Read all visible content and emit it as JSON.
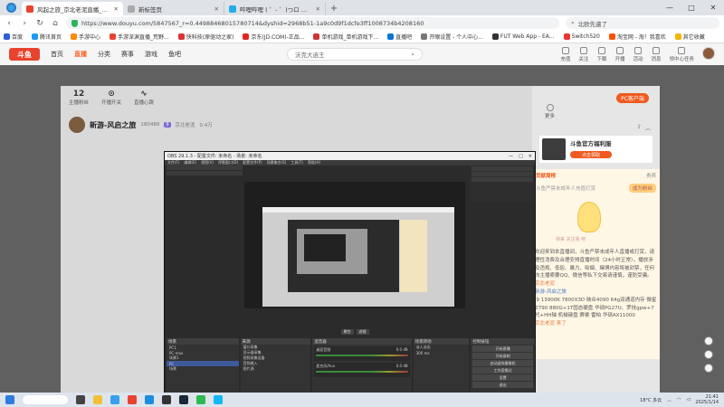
{
  "browser": {
    "tabs": [
      {
        "title": "风起之旅_京北老泥直播_斗鱼",
        "active": true,
        "color": "#e8432f"
      },
      {
        "title": "新标签页",
        "active": false,
        "color": "#aaa"
      },
      {
        "title": "哔哩哔哩 ( ゜- ゜)つロ 干杯~",
        "active": false,
        "color": "#23ade5"
      }
    ],
    "new_tab": "+",
    "window_controls": [
      "—",
      "□",
      "✕"
    ],
    "url": "https://www.douyu.com/5847567_r=0.44988468015780714&dyshid=2968b51-1a9c0d9f1dcfe3ff1008734b4208160",
    "search_box": "北欧先遣了",
    "nav": {
      "back": "‹",
      "forward": "›",
      "reload": "↻",
      "home": "⌂"
    }
  },
  "bookmarks": [
    {
      "label": "百度",
      "color": "#2f5fd0"
    },
    {
      "label": "腾讯首页",
      "color": "#1d9bf0"
    },
    {
      "label": "手游中心",
      "color": "#ff8a00"
    },
    {
      "label": "手游深渊直播_荒野...",
      "color": "#e8432f"
    },
    {
      "label": "快科技(原驱动之家)",
      "color": "#d33"
    },
    {
      "label": "京东(JD.COM)-正品...",
      "color": "#e1251b"
    },
    {
      "label": "单机游戏_单机游戏下...",
      "color": "#c33"
    },
    {
      "label": "直播吧",
      "color": "#0a74da"
    },
    {
      "label": "开眼设置 - 个人中心...",
      "color": "#777"
    },
    {
      "label": "FUT Web App - EA...",
      "color": "#333"
    },
    {
      "label": "Switch520",
      "color": "#e33"
    },
    {
      "label": "淘宝网 - 淘！我喜欢",
      "color": "#ff5000"
    },
    {
      "label": "其它收藏",
      "color": "#f5b400"
    }
  ],
  "douyu_nav": {
    "logo": "斗鱼",
    "items": [
      "首页",
      "直播",
      "分类",
      "赛事",
      "游戏",
      "鱼吧"
    ],
    "active": "直播",
    "search_placeholder": "沃克大逍王",
    "right_items": [
      "充值",
      "关注",
      "下载",
      "开播",
      "活动",
      "消息",
      "领中心任务"
    ]
  },
  "room": {
    "stats": [
      {
        "value": "12",
        "label": "主播粉丝"
      },
      {
        "value": "",
        "label": "开播开关"
      },
      {
        "value": "",
        "label": "直播心跳"
      }
    ],
    "streamer_name": "新游-风启之旅",
    "streamer_id": "180488",
    "level": "9",
    "location": "京北老泥",
    "fans": "0.4万",
    "extra": "风启之..."
  },
  "right_panel": {
    "pc_button": "PC客户端",
    "more": "更多",
    "card_title": "斗鱼官方福利服",
    "card_button": "点击领取",
    "chat_top": {
      "left": "贡献周榜",
      "right": "贵宾"
    },
    "banner": {
      "left": "斗鱼严禁未成年人充值打赏",
      "right": "成为粉丝"
    },
    "mascot_text": "快来 关注我 吧",
    "chat_lines": [
      {
        "text": "欢迎来到本直播间，斗鱼严禁未成年人直播或打赏，请理性消费及合理安排直播时间（24小时正常）。播放涉及违规、低俗、暴力、吸烟、赌博内容将被封禁，任何向主播索要QQ、微信等私下交易请谨慎，谨防受骗。",
        "cls": ""
      },
      {
        "text": "京北老泥",
        "cls": "orange"
      },
      {
        "text": "新游-风启之旅",
        "cls": "blue"
      },
      {
        "text": "i9 13900K 7800X3D 映众4090 64g双通道内存 微星Z790 880G+1T固态硬盘 华硕PG27U、罗技gpw+7代+HH轴 机械键盘 赛睿 雷柏 华硕AX11000",
        "cls": ""
      },
      {
        "text": "京北老泥 来了",
        "cls": "orange"
      }
    ]
  },
  "obs": {
    "title": "OBS 29.1.3 - 配置文件: 未命名 - 场景: 未命名",
    "menu": [
      "文件(F)",
      "编辑(E)",
      "视图(V)",
      "停靠窗口(D)",
      "配置文件(P)",
      "场景集合(S)",
      "工具(T)",
      "帮助(H)"
    ],
    "controls_row": [
      "属性",
      "滤镜"
    ],
    "docks": {
      "scenes": {
        "title": "场景",
        "items": [
          "PC1",
          "PC-max",
          "场景1",
          "PC",
          "场景"
        ],
        "selected": "PC"
      },
      "sources": {
        "title": "来源",
        "items": [
          "窗口采集",
          "显示器采集",
          "视频采集设备",
          "音频输入",
          "图片源"
        ]
      },
      "mixer": {
        "title": "混音器",
        "channels": [
          {
            "name": "桌面音频",
            "db": "0.0 dB"
          },
          {
            "name": "麦克风/Aux",
            "db": "0.0 dB"
          }
        ]
      },
      "transitions": {
        "title": "场景转场",
        "items": [
          "淡入淡出",
          "300 ms"
        ]
      },
      "controls": {
        "title": "控制按钮",
        "buttons": [
          "开始直播",
          "开始录制",
          "启动虚拟摄像机",
          "工作室模式",
          "设置",
          "退出"
        ]
      }
    },
    "status": [
      "LIVE: 00:00:00",
      "REC: 00:00:00",
      "CPU: 1.1%, 60.00 fps"
    ]
  },
  "taskbar": {
    "apps": [
      {
        "name": "start",
        "color": "#2f7ce0"
      },
      {
        "name": "search",
        "color": "#fff"
      },
      {
        "name": "taskview",
        "color": "#444"
      },
      {
        "name": "explorer",
        "color": "#f3c038"
      },
      {
        "name": "browser",
        "color": "#3aa0e8"
      },
      {
        "name": "chrome",
        "color": "#e8432f"
      },
      {
        "name": "edge",
        "color": "#1c8fdc"
      },
      {
        "name": "obs",
        "color": "#333"
      },
      {
        "name": "steam",
        "color": "#1b2838"
      },
      {
        "name": "wechat",
        "color": "#2dbb4f"
      },
      {
        "name": "qq",
        "color": "#12b7f5"
      }
    ],
    "tray": {
      "temp": "18°C 多云",
      "time": "21:41",
      "date": "2025/1/14"
    }
  }
}
